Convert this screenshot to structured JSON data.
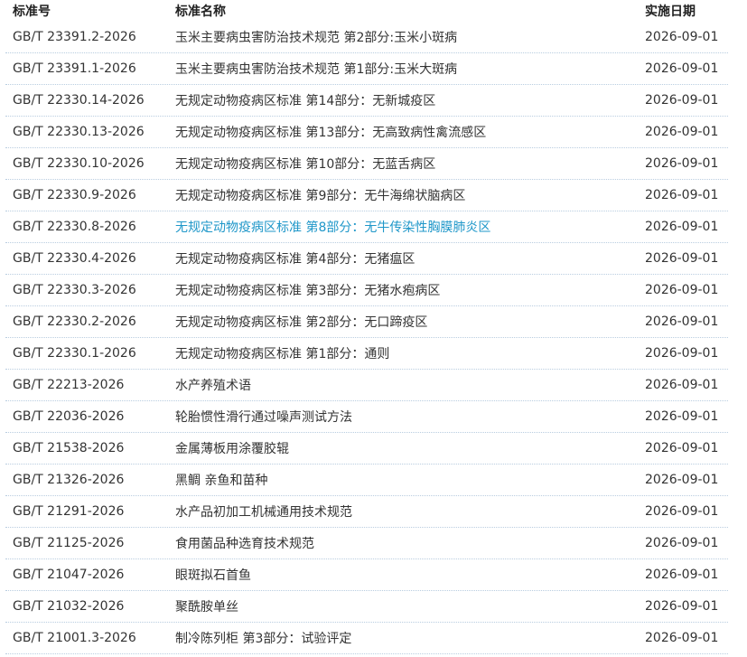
{
  "header": {
    "code": "标准号",
    "name": "标准名称",
    "date": "实施日期"
  },
  "rows": [
    {
      "code": "GB/T 23391.2-2026",
      "name": "玉米主要病虫害防治技术规范 第2部分:玉米小斑病",
      "date": "2026-09-01"
    },
    {
      "code": "GB/T 23391.1-2026",
      "name": "玉米主要病虫害防治技术规范 第1部分:玉米大斑病",
      "date": "2026-09-01"
    },
    {
      "code": "GB/T 22330.14-2026",
      "name": "无规定动物疫病区标准 第14部分：无新城疫区",
      "date": "2026-09-01"
    },
    {
      "code": "GB/T 22330.13-2026",
      "name": "无规定动物疫病区标准 第13部分：无高致病性禽流感区",
      "date": "2026-09-01"
    },
    {
      "code": "GB/T 22330.10-2026",
      "name": "无规定动物疫病区标准 第10部分：无蓝舌病区",
      "date": "2026-09-01"
    },
    {
      "code": "GB/T 22330.9-2026",
      "name": "无规定动物疫病区标准 第9部分：无牛海绵状脑病区",
      "date": "2026-09-01"
    },
    {
      "code": "GB/T 22330.8-2026",
      "name": "无规定动物疫病区标准 第8部分：无牛传染性胸膜肺炎区",
      "date": "2026-09-01",
      "highlight": true
    },
    {
      "code": "GB/T 22330.4-2026",
      "name": "无规定动物疫病区标准 第4部分：无猪瘟区",
      "date": "2026-09-01"
    },
    {
      "code": "GB/T 22330.3-2026",
      "name": "无规定动物疫病区标准 第3部分：无猪水疱病区",
      "date": "2026-09-01"
    },
    {
      "code": "GB/T 22330.2-2026",
      "name": "无规定动物疫病区标准 第2部分：无口蹄疫区",
      "date": "2026-09-01"
    },
    {
      "code": "GB/T 22330.1-2026",
      "name": "无规定动物疫病区标准 第1部分：通则",
      "date": "2026-09-01"
    },
    {
      "code": "GB/T 22213-2026",
      "name": "水产养殖术语",
      "date": "2026-09-01"
    },
    {
      "code": "GB/T 22036-2026",
      "name": "轮胎惯性滑行通过噪声测试方法",
      "date": "2026-09-01"
    },
    {
      "code": "GB/T 21538-2026",
      "name": "金属薄板用涂覆胶辊",
      "date": "2026-09-01"
    },
    {
      "code": "GB/T 21326-2026",
      "name": "黑鲷 亲鱼和苗种",
      "date": "2026-09-01"
    },
    {
      "code": "GB/T 21291-2026",
      "name": "水产品初加工机械通用技术规范",
      "date": "2026-09-01"
    },
    {
      "code": "GB/T 21125-2026",
      "name": "食用菌品种选育技术规范",
      "date": "2026-09-01"
    },
    {
      "code": "GB/T 21047-2026",
      "name": "眼斑拟石首鱼",
      "date": "2026-09-01"
    },
    {
      "code": "GB/T 21032-2026",
      "name": "聚酰胺单丝",
      "date": "2026-09-01"
    },
    {
      "code": "GB/T 21001.3-2026",
      "name": "制冷陈列柜 第3部分：试验评定",
      "date": "2026-09-01"
    }
  ]
}
